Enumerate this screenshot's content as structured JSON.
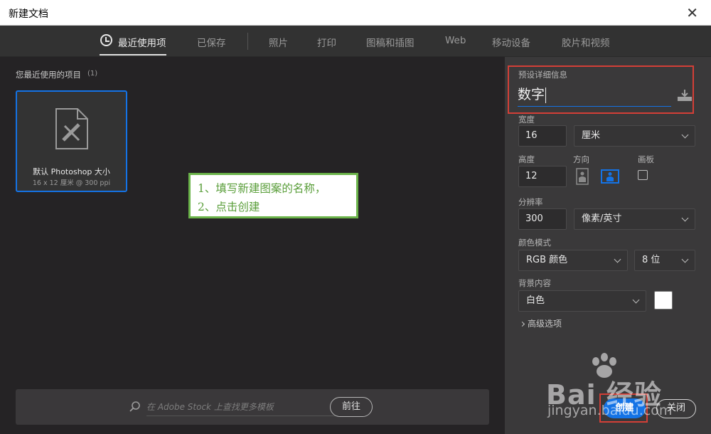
{
  "window": {
    "title": "新建文档",
    "close_symbol": "✕"
  },
  "tabs": [
    {
      "label": "最近使用项"
    },
    {
      "label": "已保存"
    },
    {
      "label": "照片"
    },
    {
      "label": "打印"
    },
    {
      "label": "图稿和插图"
    },
    {
      "label": "Web"
    },
    {
      "label": "移动设备"
    },
    {
      "label": "胶片和视频"
    }
  ],
  "recent": {
    "title": "您最近使用的项目",
    "count": "(1)",
    "items": [
      {
        "name": "默认 Photoshop 大小",
        "meta": "16 x 12 厘米 @ 300 ppi"
      }
    ]
  },
  "annotation": {
    "line1": "1、填写新建图案的名称，",
    "line2": "2、点击创建"
  },
  "stock": {
    "placeholder": "在 Adobe Stock 上查找更多模板",
    "go_label": "前往"
  },
  "preset": {
    "section_label": "预设详细信息",
    "doc_name": "数字",
    "width_label": "宽度",
    "width_value": "16",
    "width_unit": "厘米",
    "height_label": "高度",
    "height_value": "12",
    "orientation_label": "方向",
    "artboard_label": "画板",
    "resolution_label": "分辨率",
    "resolution_value": "300",
    "resolution_unit": "像素/英寸",
    "color_mode_label": "颜色模式",
    "color_mode": "RGB 颜色",
    "bit_depth": "8 位",
    "background_label": "背景内容",
    "background": "白色",
    "background_color": "#ffffff",
    "advanced_label": "高级选项"
  },
  "buttons": {
    "create": "创建",
    "close": "关闭"
  },
  "watermark": {
    "text": "Bai 经验",
    "url": "jingyan.baidu.com"
  },
  "colors": {
    "accent": "#1473e6",
    "highlight_red": "#d33f37",
    "note_green": "#6bb34a"
  }
}
